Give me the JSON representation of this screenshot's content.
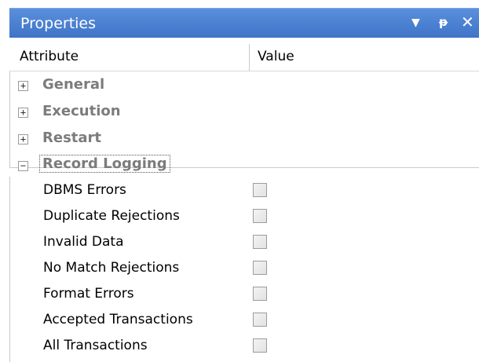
{
  "titlebar": {
    "title": "Properties",
    "dropdown_icon": "▼",
    "pin_icon": "ᵖ",
    "close_icon": "✕"
  },
  "columns": {
    "attribute": "Attribute",
    "value": "Value"
  },
  "groups": [
    {
      "label": "General",
      "expanded": false,
      "expander": "+"
    },
    {
      "label": "Execution",
      "expanded": false,
      "expander": "+"
    },
    {
      "label": "Restart",
      "expanded": false,
      "expander": "+"
    },
    {
      "label": "Record Logging",
      "expanded": true,
      "expander": "−"
    }
  ],
  "record_logging_items": [
    {
      "label": "DBMS Errors",
      "checked": false
    },
    {
      "label": "Duplicate Rejections",
      "checked": false
    },
    {
      "label": "Invalid Data",
      "checked": false
    },
    {
      "label": "No Match Rejections",
      "checked": false
    },
    {
      "label": "Format Errors",
      "checked": false
    },
    {
      "label": "Accepted Transactions",
      "checked": false
    },
    {
      "label": "All Transactions",
      "checked": false
    }
  ],
  "colors": {
    "titlebar": "#4a82d4",
    "group_text": "#7c7c7c"
  }
}
